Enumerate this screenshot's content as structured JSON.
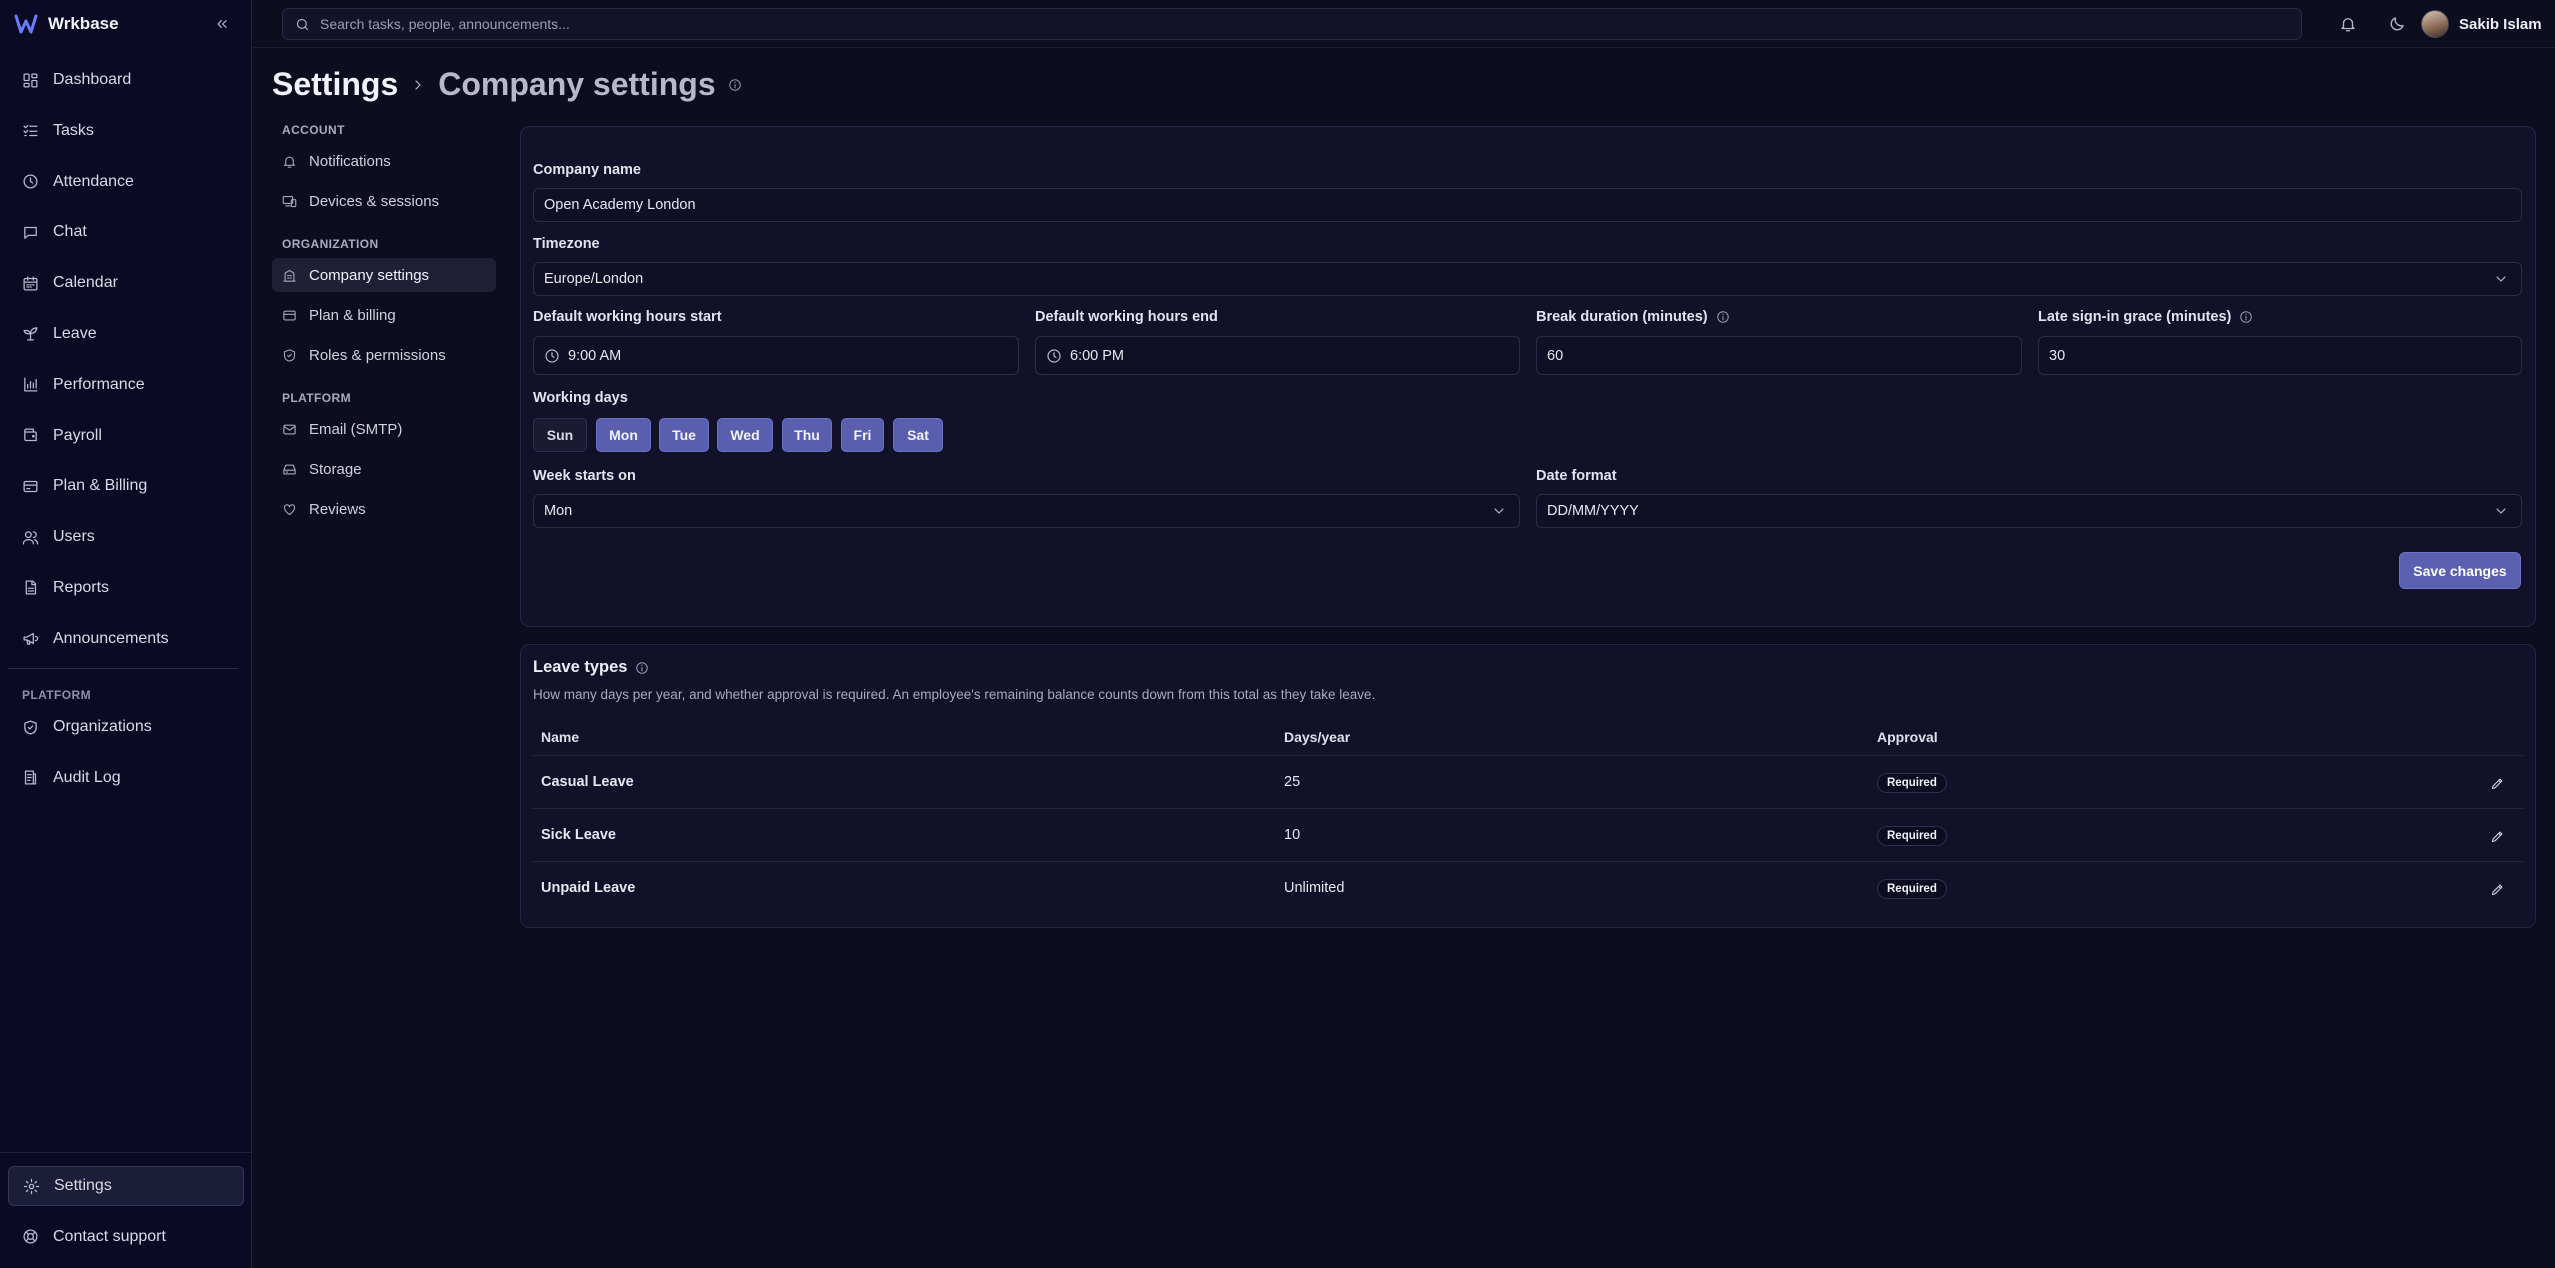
{
  "brand": {
    "name": "Wrkbase",
    "accent": "#5b5fb0"
  },
  "sidebar": {
    "items": [
      {
        "label": "Dashboard",
        "icon": "dashboard-icon"
      },
      {
        "label": "Tasks",
        "icon": "tasks-icon"
      },
      {
        "label": "Attendance",
        "icon": "clock-icon"
      },
      {
        "label": "Chat",
        "icon": "chat-icon"
      },
      {
        "label": "Calendar",
        "icon": "calendar-icon"
      },
      {
        "label": "Leave",
        "icon": "leave-icon"
      },
      {
        "label": "Performance",
        "icon": "chart-icon"
      },
      {
        "label": "Payroll",
        "icon": "wallet-icon"
      },
      {
        "label": "Plan & Billing",
        "icon": "card-icon"
      },
      {
        "label": "Users",
        "icon": "users-icon"
      },
      {
        "label": "Reports",
        "icon": "report-icon"
      },
      {
        "label": "Announcements",
        "icon": "megaphone-icon"
      }
    ],
    "platform_section": "PLATFORM",
    "platform_items": [
      {
        "label": "Organizations",
        "icon": "shield-icon"
      },
      {
        "label": "Audit Log",
        "icon": "audit-icon"
      }
    ],
    "bottom_items": [
      {
        "label": "Settings",
        "icon": "gear-icon"
      },
      {
        "label": "Contact support",
        "icon": "support-icon"
      }
    ]
  },
  "topbar": {
    "search_placeholder": "Search tasks, people, announcements...",
    "user_name": "Sakib Islam"
  },
  "header": {
    "crumb1": "Settings",
    "crumb2": "Company settings"
  },
  "settings_menu": {
    "account_label": "ACCOUNT",
    "account_items": [
      "Notifications",
      "Devices & sessions"
    ],
    "organization_label": "ORGANIZATION",
    "organization_items": [
      "Company settings",
      "Plan & billing",
      "Roles & permissions"
    ],
    "platform_label": "PLATFORM",
    "platform_items": [
      "Email (SMTP)",
      "Storage",
      "Reviews"
    ]
  },
  "company_form": {
    "company_name_label": "Company name",
    "company_name_value": "Open Academy London",
    "timezone_label": "Timezone",
    "timezone_value": "Europe/London",
    "hours_start_label": "Default working hours start",
    "hours_start_value": "9:00 AM",
    "hours_end_label": "Default working hours end",
    "hours_end_value": "6:00 PM",
    "break_label": "Break duration (minutes)",
    "break_value": "60",
    "grace_label": "Late sign-in grace (minutes)",
    "grace_value": "30",
    "working_days_label": "Working days",
    "days": [
      {
        "label": "Sun",
        "selected": false
      },
      {
        "label": "Mon",
        "selected": true
      },
      {
        "label": "Tue",
        "selected": true
      },
      {
        "label": "Wed",
        "selected": true
      },
      {
        "label": "Thu",
        "selected": true
      },
      {
        "label": "Fri",
        "selected": true
      },
      {
        "label": "Sat",
        "selected": true
      }
    ],
    "week_start_label": "Week starts on",
    "week_start_value": "Mon",
    "date_format_label": "Date format",
    "date_format_value": "DD/MM/YYYY",
    "save_label": "Save changes"
  },
  "leave_types": {
    "title": "Leave types",
    "description": "How many days per year, and whether approval is required. An employee's remaining balance counts down from this total as they take leave.",
    "columns": [
      "Name",
      "Days/year",
      "Approval"
    ],
    "rows": [
      {
        "name": "Casual Leave",
        "days": "25",
        "approval": "Required"
      },
      {
        "name": "Sick Leave",
        "days": "10",
        "approval": "Required"
      },
      {
        "name": "Unpaid Leave",
        "days": "Unlimited",
        "approval": "Required"
      }
    ]
  }
}
